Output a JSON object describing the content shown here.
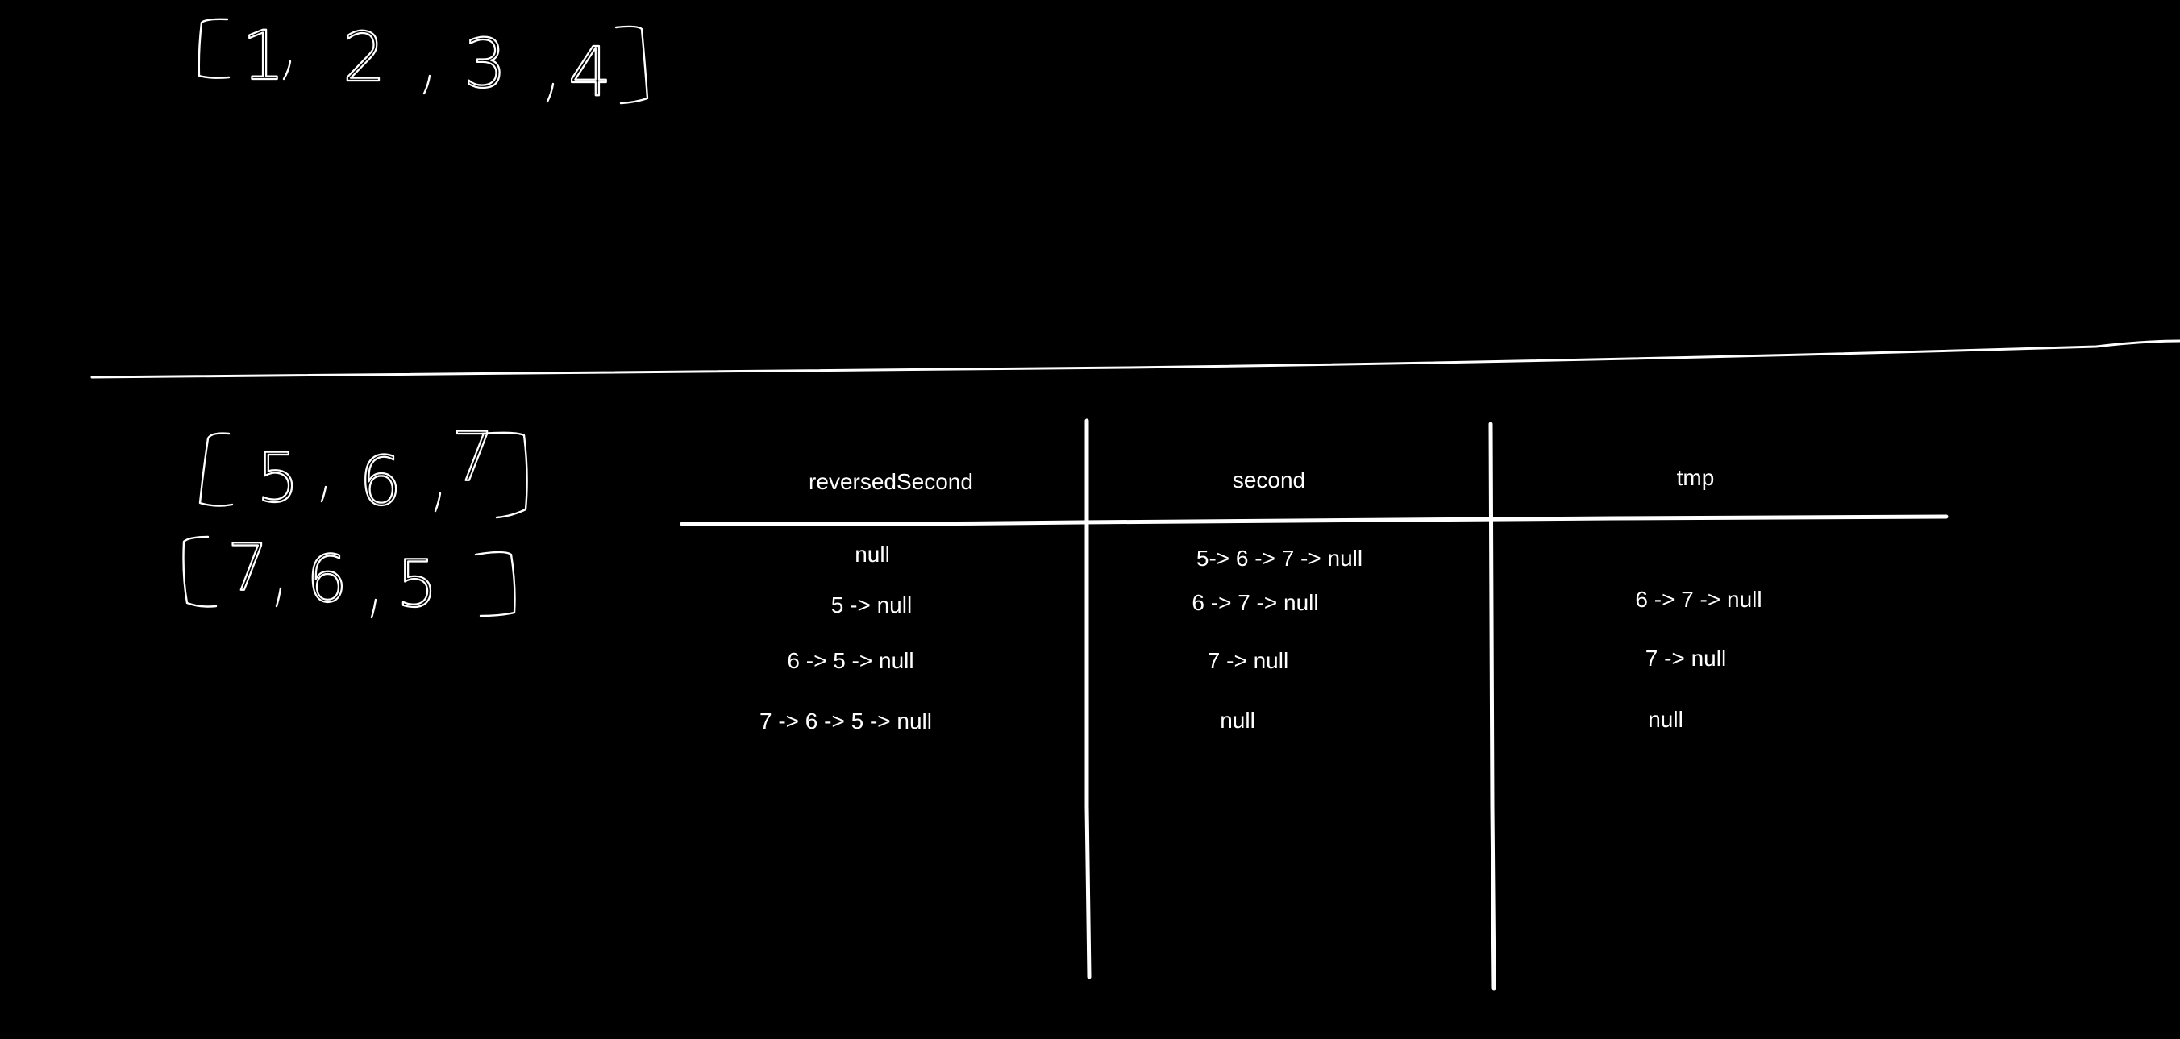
{
  "canvas": {
    "background": "#000000",
    "ink": "#ffffff"
  },
  "handwritten": {
    "first_array": [
      "1",
      "2",
      "3",
      "4"
    ],
    "second_array": [
      "5",
      "6",
      "7"
    ],
    "second_array_reversed": [
      "7",
      "6",
      "5"
    ]
  },
  "table": {
    "headers": [
      "reversedSecond",
      "second",
      "tmp"
    ],
    "rows": [
      [
        "null",
        "5-> 6 -> 7 -> null",
        ""
      ],
      [
        "5 -> null",
        "6 -> 7 -> null",
        "6 -> 7 -> null"
      ],
      [
        "6 -> 5 -> null",
        "7 -> null",
        "7 -> null"
      ],
      [
        "7 -> 6 -> 5 -> null",
        "null",
        "null"
      ]
    ]
  }
}
